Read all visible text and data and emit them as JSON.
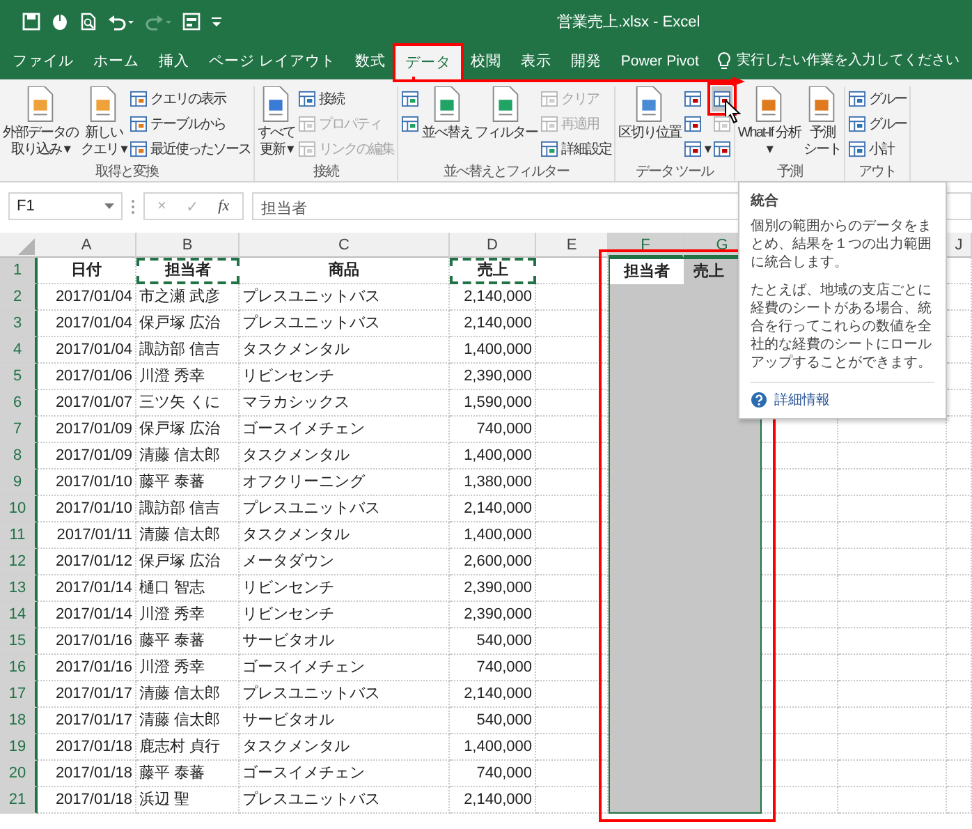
{
  "window": {
    "title": "営業売上.xlsx  -  Excel"
  },
  "tabs": [
    {
      "label": "ファイル",
      "selected": false,
      "annotated": false
    },
    {
      "label": "ホーム",
      "selected": false,
      "annotated": false
    },
    {
      "label": "挿入",
      "selected": false,
      "annotated": false
    },
    {
      "label": "ページ レイアウト",
      "selected": false,
      "annotated": false
    },
    {
      "label": "数式",
      "selected": false,
      "annotated": false
    },
    {
      "label": "データ",
      "selected": true,
      "annotated": true
    },
    {
      "label": "校閲",
      "selected": false,
      "annotated": false
    },
    {
      "label": "表示",
      "selected": false,
      "annotated": false
    },
    {
      "label": "開発",
      "selected": false,
      "annotated": false
    },
    {
      "label": "Power Pivot",
      "selected": false,
      "annotated": false
    }
  ],
  "tell_me": {
    "placeholder": "実行したい作業を入力してください"
  },
  "ribbon": {
    "groups": [
      {
        "label": "取得と変換",
        "items": [
          {
            "kind": "large",
            "lines": [
              "外部データの",
              "取り込み ▾"
            ]
          },
          {
            "kind": "large",
            "lines": [
              "新しい",
              "クエリ ▾"
            ]
          },
          {
            "kind": "stack",
            "entries": [
              {
                "label": "クエリの表示",
                "disabled": false
              },
              {
                "label": "テーブルから",
                "disabled": false
              },
              {
                "label": "最近使ったソース",
                "disabled": false
              }
            ]
          }
        ]
      },
      {
        "label": "接続",
        "items": [
          {
            "kind": "large",
            "lines": [
              "すべて",
              "更新 ▾"
            ]
          },
          {
            "kind": "stack",
            "entries": [
              {
                "label": "接続",
                "disabled": false
              },
              {
                "label": "プロパティ",
                "disabled": true
              },
              {
                "label": "リンクの編集",
                "disabled": true
              }
            ]
          }
        ]
      },
      {
        "label": "並べ替えとフィルター",
        "items": [
          {
            "kind": "stack",
            "entries": [
              {
                "disabled": false
              },
              {
                "disabled": false
              }
            ]
          },
          {
            "kind": "large",
            "lines": [
              "並べ替え"
            ]
          },
          {
            "kind": "large",
            "lines": [
              "フィルター"
            ]
          },
          {
            "kind": "stack",
            "entries": [
              {
                "label": "クリア",
                "disabled": true
              },
              {
                "label": "再適用",
                "disabled": true
              },
              {
                "label": "詳細設定",
                "disabled": false
              }
            ]
          }
        ]
      },
      {
        "label": "データ ツール",
        "items": [
          {
            "kind": "large",
            "lines": [
              "区切り位置"
            ]
          },
          {
            "kind": "stack",
            "entries": [
              {
                "disabled": false,
                "highlighted": false,
                "annotated": false
              },
              {
                "disabled": false,
                "highlighted": false,
                "annotated": false
              },
              {
                "label": "▾",
                "disabled": false,
                "highlighted": false,
                "annotated": false
              }
            ]
          },
          {
            "kind": "stack",
            "entries": [
              {
                "disabled": false,
                "highlighted": true,
                "annotated": true
              },
              {
                "disabled": true,
                "highlighted": false,
                "annotated": false
              },
              {
                "disabled": false,
                "highlighted": false,
                "annotated": false
              }
            ]
          }
        ]
      },
      {
        "label": "予測",
        "items": [
          {
            "kind": "large",
            "lines": [
              "What-If 分析",
              "▾"
            ]
          },
          {
            "kind": "large",
            "lines": [
              "予測",
              "シート"
            ]
          }
        ]
      },
      {
        "label": "アウト",
        "items": [
          {
            "kind": "stack",
            "entries": [
              {
                "label": "グルー",
                "disabled": false
              },
              {
                "label": "グルー",
                "disabled": false
              },
              {
                "label": "小計",
                "disabled": false
              }
            ]
          }
        ]
      }
    ]
  },
  "formula_bar": {
    "name_box": "F1",
    "buttons": [
      "×",
      "✓",
      "fx"
    ],
    "value": "担当者"
  },
  "sheet": {
    "column_headers": [
      {
        "letter": "A",
        "selected": false
      },
      {
        "letter": "B",
        "selected": false
      },
      {
        "letter": "C",
        "selected": false
      },
      {
        "letter": "D",
        "selected": false
      },
      {
        "letter": "E",
        "selected": false
      },
      {
        "letter": "F",
        "selected": true
      },
      {
        "letter": "G",
        "selected": true
      },
      {
        "letter": "J",
        "selected": false
      }
    ],
    "header_row": {
      "num": "1",
      "selected": true,
      "cells": [
        {
          "text": "日付",
          "copied": false
        },
        {
          "text": "担当者",
          "copied": true
        },
        {
          "text": "商品",
          "copied": false
        },
        {
          "text": "売上",
          "copied": true
        }
      ],
      "target": [
        {
          "text": "担当者",
          "active": true
        },
        {
          "text": "売上",
          "active": false
        }
      ]
    },
    "rows": [
      {
        "num": "2",
        "selected": true,
        "cells": [
          "2017/01/04",
          "市之瀬 武彦",
          "プレスユニットバス",
          "2,140,000"
        ]
      },
      {
        "num": "3",
        "selected": true,
        "cells": [
          "2017/01/04",
          "保戸塚 広治",
          "プレスユニットバス",
          "2,140,000"
        ]
      },
      {
        "num": "4",
        "selected": true,
        "cells": [
          "2017/01/04",
          "諏訪部 信吉",
          "タスクメンタル",
          "1,400,000"
        ]
      },
      {
        "num": "5",
        "selected": true,
        "cells": [
          "2017/01/06",
          "川澄 秀幸",
          "リビンセンチ",
          "2,390,000"
        ]
      },
      {
        "num": "6",
        "selected": true,
        "cells": [
          "2017/01/07",
          "三ツ矢 くに",
          "マラカシックス",
          "1,590,000"
        ]
      },
      {
        "num": "7",
        "selected": true,
        "cells": [
          "2017/01/09",
          "保戸塚 広治",
          "ゴースイメチェン",
          "740,000"
        ]
      },
      {
        "num": "8",
        "selected": true,
        "cells": [
          "2017/01/09",
          "清藤 信太郎",
          "タスクメンタル",
          "1,400,000"
        ]
      },
      {
        "num": "9",
        "selected": true,
        "cells": [
          "2017/01/10",
          "藤平 泰蕃",
          "オフクリーニング",
          "1,380,000"
        ]
      },
      {
        "num": "10",
        "selected": true,
        "cells": [
          "2017/01/10",
          "諏訪部 信吉",
          "プレスユニットバス",
          "2,140,000"
        ]
      },
      {
        "num": "11",
        "selected": true,
        "cells": [
          "2017/01/11",
          "清藤 信太郎",
          "タスクメンタル",
          "1,400,000"
        ]
      },
      {
        "num": "12",
        "selected": true,
        "cells": [
          "2017/01/12",
          "保戸塚 広治",
          "メータダウン",
          "2,600,000"
        ]
      },
      {
        "num": "13",
        "selected": true,
        "cells": [
          "2017/01/14",
          "樋口 智志",
          "リビンセンチ",
          "2,390,000"
        ]
      },
      {
        "num": "14",
        "selected": true,
        "cells": [
          "2017/01/14",
          "川澄 秀幸",
          "リビンセンチ",
          "2,390,000"
        ]
      },
      {
        "num": "15",
        "selected": true,
        "cells": [
          "2017/01/16",
          "藤平 泰蕃",
          "サービタオル",
          "540,000"
        ]
      },
      {
        "num": "16",
        "selected": true,
        "cells": [
          "2017/01/16",
          "川澄 秀幸",
          "ゴースイメチェン",
          "740,000"
        ]
      },
      {
        "num": "17",
        "selected": true,
        "cells": [
          "2017/01/17",
          "清藤 信太郎",
          "プレスユニットバス",
          "2,140,000"
        ]
      },
      {
        "num": "18",
        "selected": true,
        "cells": [
          "2017/01/17",
          "清藤 信太郎",
          "サービタオル",
          "540,000"
        ]
      },
      {
        "num": "19",
        "selected": true,
        "cells": [
          "2017/01/18",
          "鹿志村 貞行",
          "タスクメンタル",
          "1,400,000"
        ]
      },
      {
        "num": "20",
        "selected": true,
        "cells": [
          "2017/01/18",
          "藤平 泰蕃",
          "ゴースイメチェン",
          "740,000"
        ]
      },
      {
        "num": "21",
        "selected": true,
        "cells": [
          "2017/01/18",
          "浜辺 聖",
          "プレスユニットバス",
          "2,140,000"
        ]
      }
    ]
  },
  "tooltip": {
    "title": "統合",
    "paragraphs": [
      "個別の範囲からのデータをまとめ、結果を１つの出力範囲に統合します。",
      "たとえば、地域の支店ごとに経費のシートがある場合、統合を行ってこれらの数値を全社的な経費のシートにロールアップすることができます。"
    ],
    "link": "詳細情報"
  }
}
